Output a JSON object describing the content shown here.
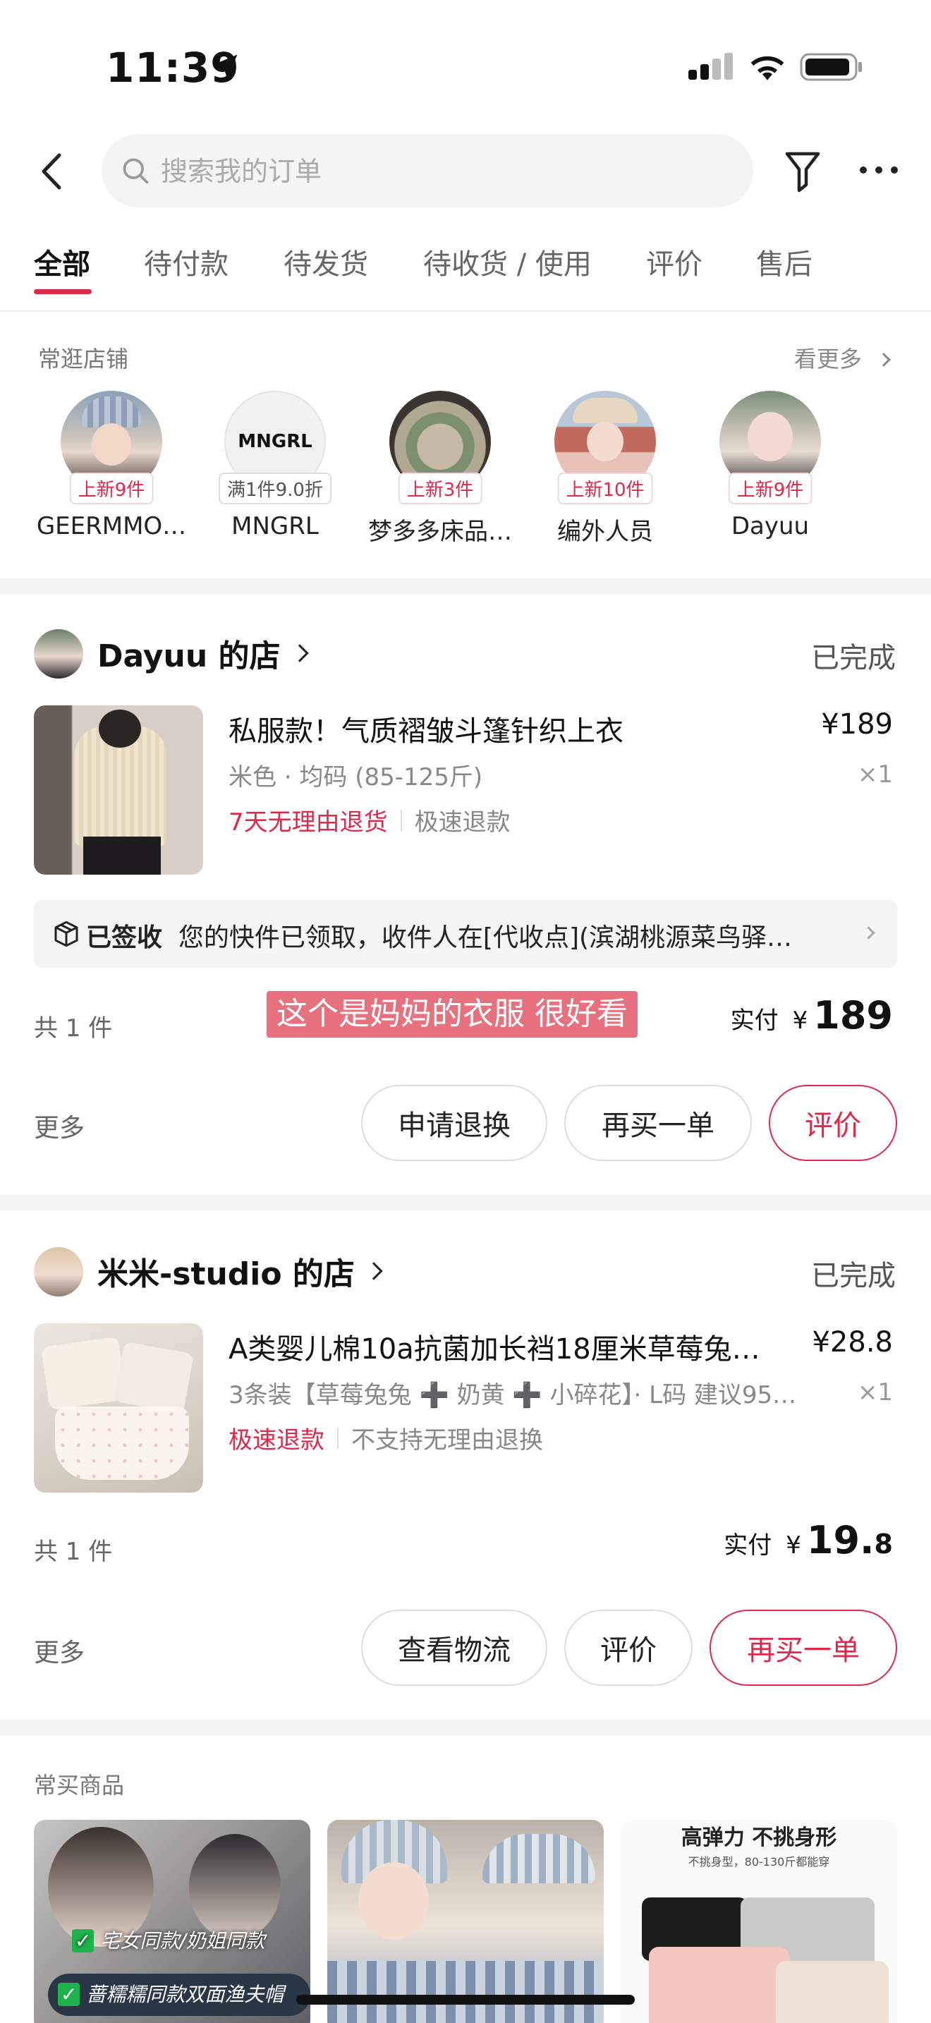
{
  "status_bar": {
    "time": "11:39"
  },
  "header": {
    "search_placeholder": "搜索我的订单"
  },
  "tabs": [
    {
      "label": "全部",
      "active": true
    },
    {
      "label": "待付款"
    },
    {
      "label": "待发货"
    },
    {
      "label": "待收货 / 使用"
    },
    {
      "label": "评价"
    },
    {
      "label": "售后"
    }
  ],
  "frequent_shops": {
    "title": "常逛店铺",
    "see_more": "看更多",
    "shops": [
      {
        "name": "GEERMMO…",
        "badge": "上新9件"
      },
      {
        "name": "MNGRL",
        "badge": "满1件9.0折",
        "logo_text": "MNGRL"
      },
      {
        "name": "梦多多床品…",
        "badge": "上新3件"
      },
      {
        "name": "编外人员",
        "badge": "上新10件"
      },
      {
        "name": "Dayuu",
        "badge": "上新9件"
      }
    ]
  },
  "orders": [
    {
      "store": "Dayuu 的店",
      "status": "已完成",
      "product_title": "私服款！气质褶皱斗篷针织上衣",
      "spec": "米色 · 均码 (85-125斤)",
      "price": "¥189",
      "qty": "×1",
      "tag1": "7天无理由退货",
      "tag2": "极速退款",
      "shipping_label": "已签收",
      "shipping_text": "您的快件已领取，收件人在[代收点](滨湖桃源菜鸟驿…",
      "count": "共 1 件",
      "overlay_text": "这个是妈妈的衣服 很好看",
      "paid_label": "实付",
      "paid_currency": "¥",
      "paid_int": "189",
      "paid_dec": "",
      "more": "更多",
      "buttons": [
        "申请退换",
        "再买一单",
        "评价"
      ]
    },
    {
      "store": "米米-studio 的店",
      "status": "已完成",
      "product_title": "A类婴儿棉10a抗菌加长裆18厘米草莓兔…",
      "spec": "3条装【草莓兔兔 ➕ 奶黄 ➕ 小碎花】· L码 建议95…",
      "price": "¥28.8",
      "qty": "×1",
      "tag1": "极速退款",
      "tag2": "不支持无理由退换",
      "count": "共 1 件",
      "paid_label": "实付",
      "paid_currency": "¥",
      "paid_int": "19.",
      "paid_dec": "8",
      "more": "更多",
      "buttons": [
        "查看物流",
        "评价",
        "再买一单"
      ]
    }
  ],
  "frequent_buys": {
    "title": "常买商品",
    "items": [
      {
        "line1": "宅女同款/奶姐同款",
        "line2": "蔷糯糯同款双面渔夫帽"
      },
      {},
      {
        "header": "高弹力 不挑身形",
        "sub": "不挑身型，80-130斤都能穿"
      }
    ]
  },
  "colors": {
    "accent": "#e0294a"
  }
}
